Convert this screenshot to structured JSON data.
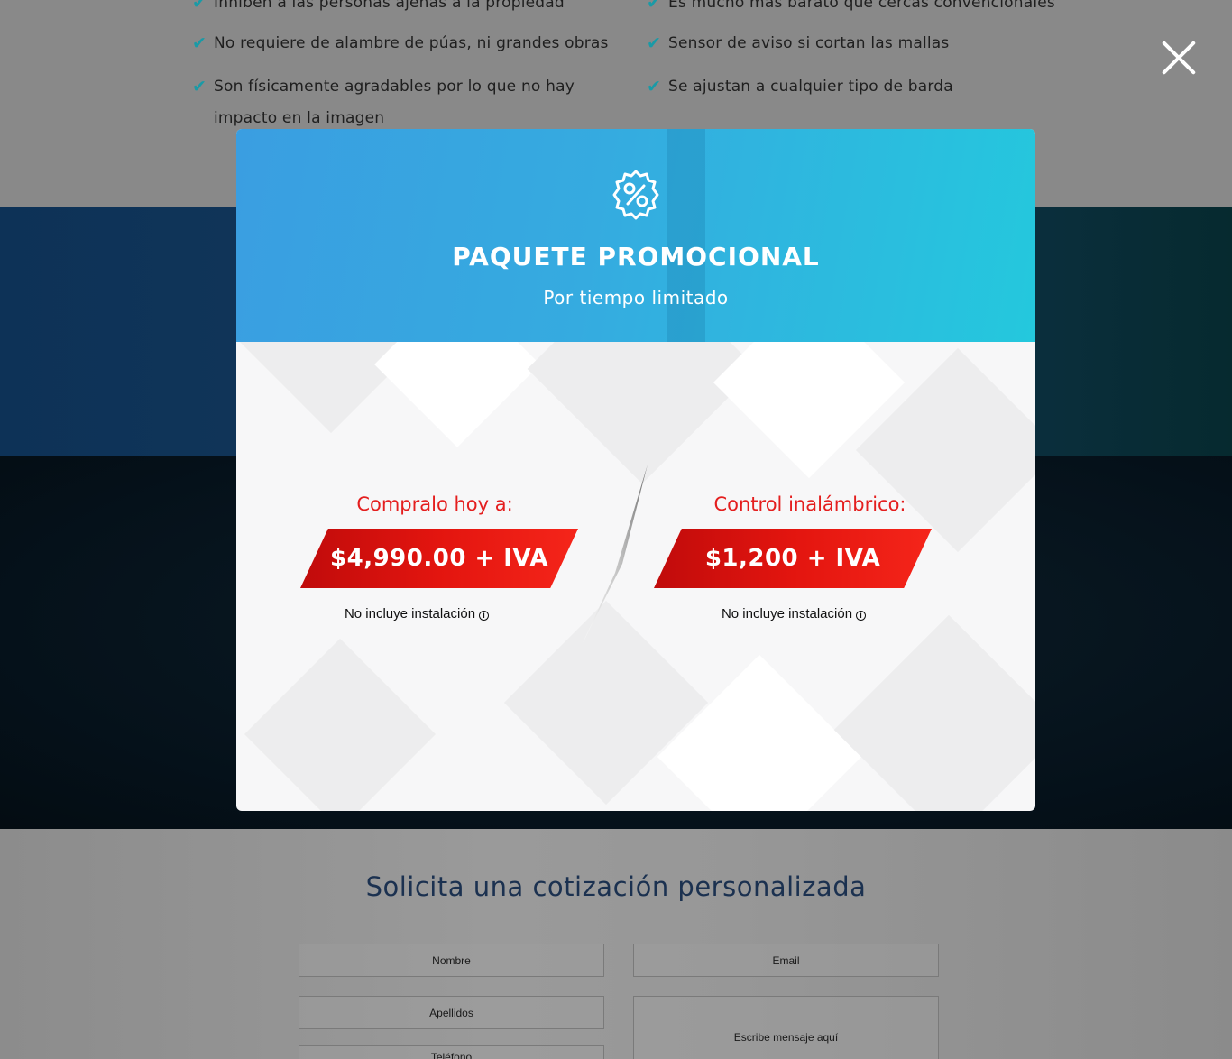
{
  "features": {
    "left": [
      "Inhiben a las personas ajenas a la propiedad",
      "No requiere de alambre de púas, ni grandes obras",
      "Son físicamente agradables por lo que no hay",
      "impacto en la imagen"
    ],
    "right": [
      "Es mucho más barato que cercas convencionales",
      "Sensor de aviso si cortan las mallas",
      "Se ajustan a cualquier tipo de barda"
    ],
    "check_icon": "check-icon"
  },
  "modal": {
    "icon": "percent-badge-icon",
    "title": "PAQUETE PROMOCIONAL",
    "subtitle": "Por tiempo limitado",
    "offers": [
      {
        "label": "Compralo hoy a:",
        "price": "$4,990.00 + IVA",
        "note": "No incluye instalación"
      },
      {
        "label": "Control inalámbrico:",
        "price": "$1,200 + IVA",
        "note": "No incluye instalación"
      }
    ],
    "info_icon": "info-icon"
  },
  "form": {
    "title": "Solicita una cotización personalizada",
    "nombre": "Nombre",
    "email": "Email",
    "apellidos": "Apellidos",
    "telefono": "Teléfono",
    "mensaje": "Escribe mensaje aquí"
  },
  "colors": {
    "accent_red": "#e41e1e",
    "header_blue": "#35abe0",
    "header_cyan": "#24c8dd",
    "check_teal": "#1a9aa6"
  }
}
